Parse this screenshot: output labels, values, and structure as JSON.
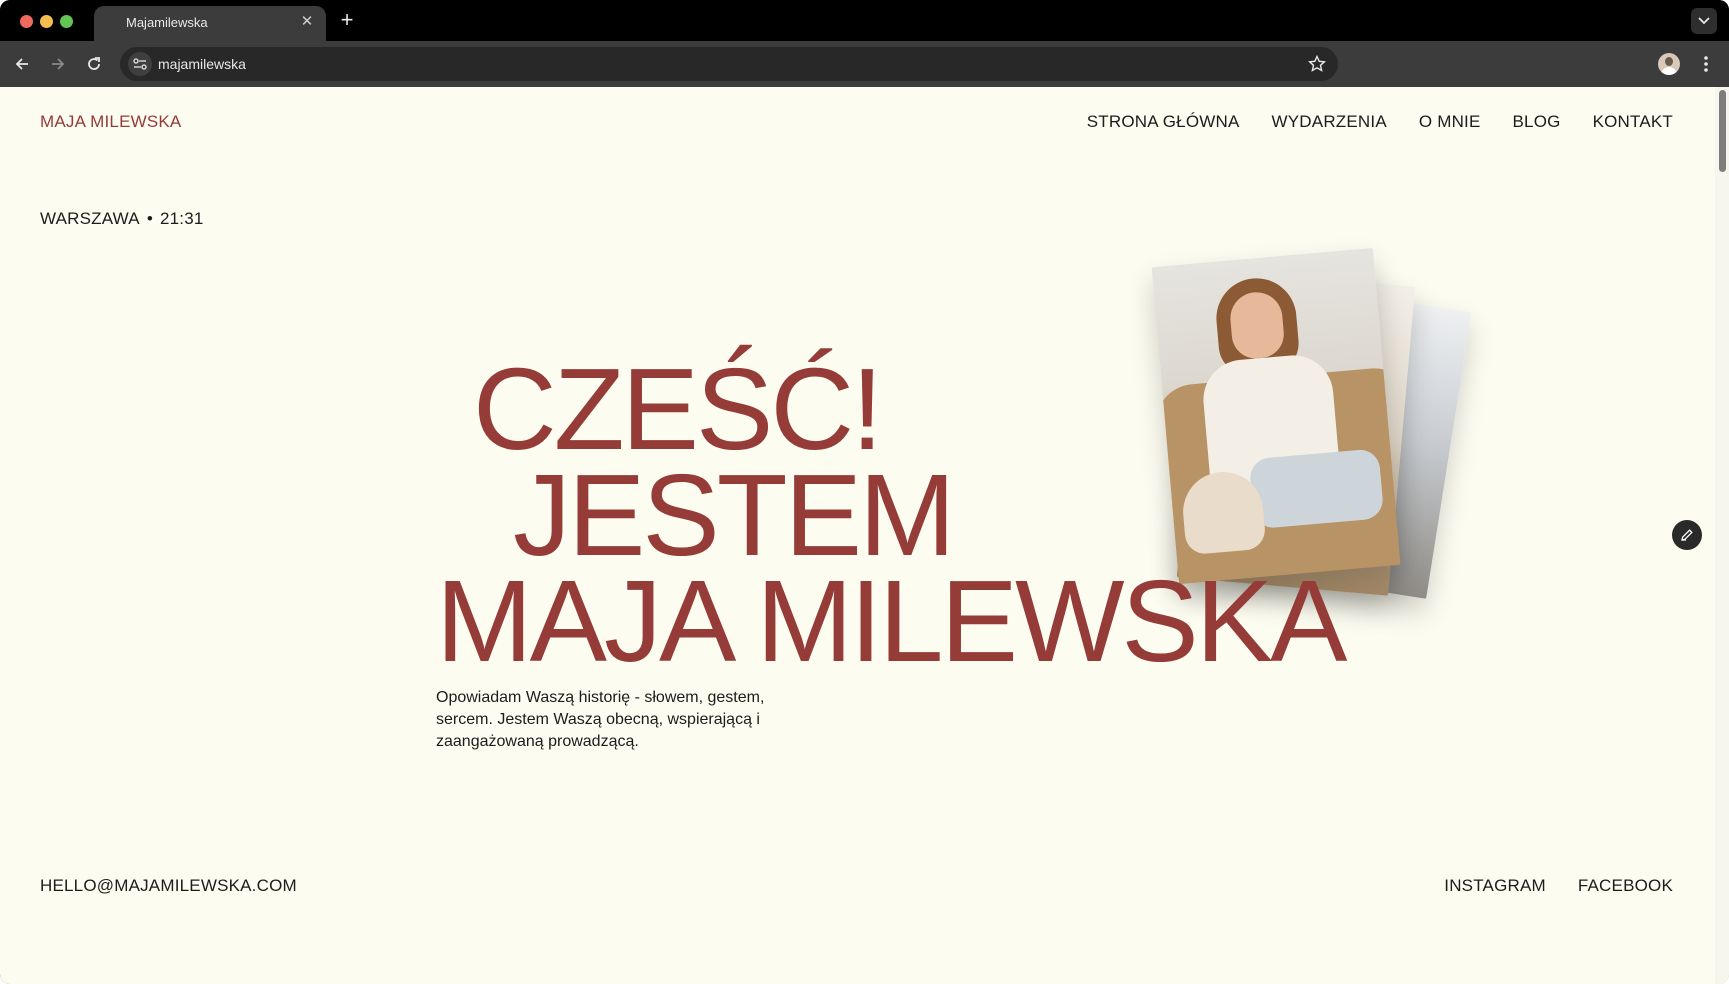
{
  "browser": {
    "tab_title": "Majamilewska",
    "url": "majamilewska"
  },
  "site": {
    "brand": "MAJA MILEWSKA",
    "nav": [
      {
        "label": "STRONA GŁÓWNA"
      },
      {
        "label": "WYDARZENIA"
      },
      {
        "label": "O MNIE"
      },
      {
        "label": "BLOG"
      },
      {
        "label": "KONTAKT"
      }
    ],
    "location": "WARSZAWA",
    "time": "21:31",
    "hero": {
      "line1": "CZEŚĆ!",
      "line2": "JESTEM",
      "line3": "MAJA MILEWSKA"
    },
    "intro": "Opowiadam Waszą historię - słowem, gestem, sercem. Jestem Waszą obecną, wspierającą i zaangażowaną prowadzącą.",
    "footer": {
      "email": "HELLO@MAJAMILEWSKA.COM",
      "social": [
        {
          "label": "INSTAGRAM"
        },
        {
          "label": "FACEBOOK"
        }
      ]
    }
  },
  "colors": {
    "accent": "#953b38",
    "page_background": "#fdfcf1",
    "text": "#1c1c1c"
  },
  "icons": [
    "back-arrow-icon",
    "forward-arrow-icon",
    "reload-icon",
    "site-settings-icon",
    "bookmark-star-icon",
    "profile-avatar-icon",
    "kebab-menu-icon",
    "pencil-edit-icon",
    "close-icon",
    "plus-icon",
    "chevron-down-icon"
  ]
}
